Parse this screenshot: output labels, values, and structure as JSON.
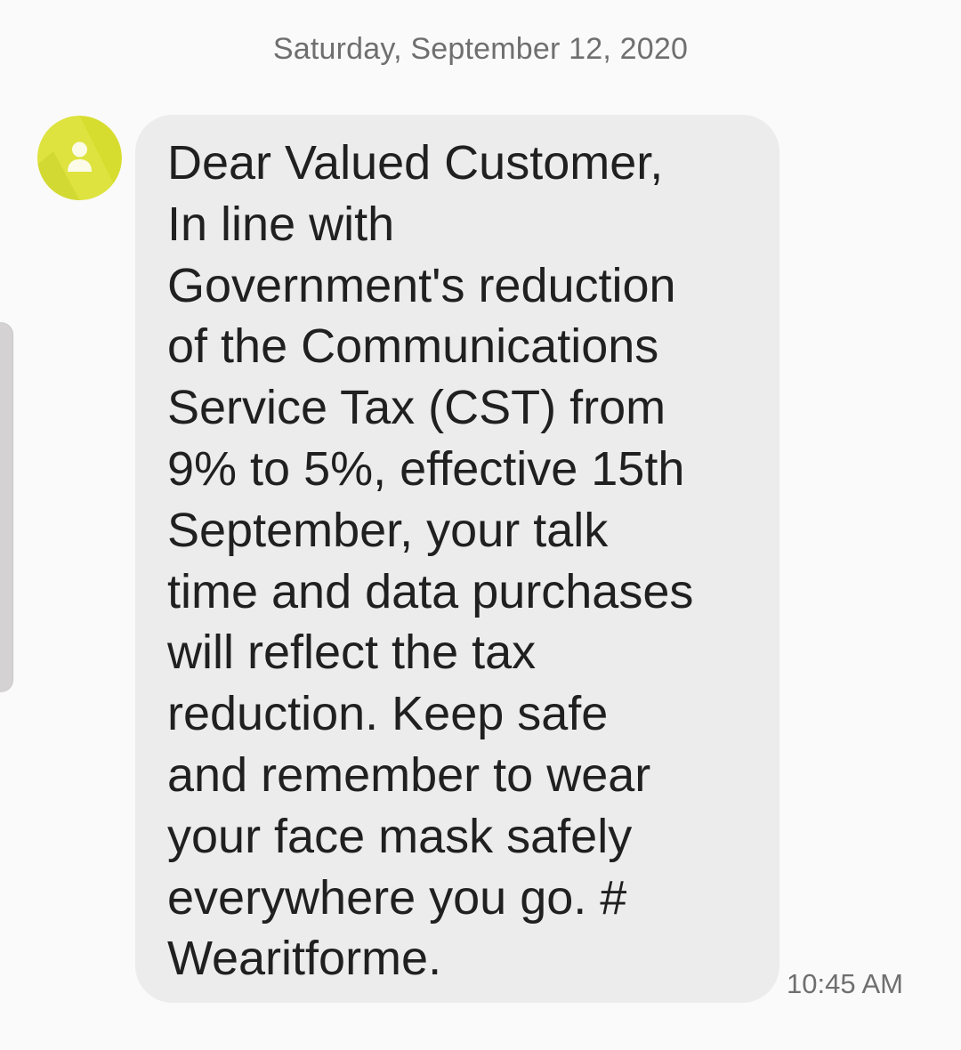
{
  "conversation": {
    "date_header": "Saturday, September 12, 2020"
  },
  "message": {
    "sender_avatar_icon": "person-icon",
    "avatar_color": "#d7dd2f",
    "bubble_color": "#ececec",
    "lines": [
      "Dear Valued Customer,",
      "In line with",
      "Government's reduction",
      "of the Communications",
      "Service Tax (CST) from",
      "9% to 5%, effective 15th",
      "September, your talk",
      "time and data purchases",
      "will reflect the tax",
      "reduction. Keep safe",
      "and remember to wear",
      "your face mask safely",
      "everywhere you go. #",
      "Wearitforme."
    ],
    "timestamp": "10:45 AM"
  }
}
